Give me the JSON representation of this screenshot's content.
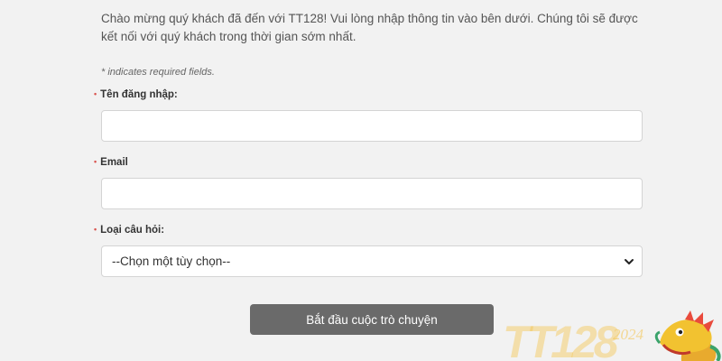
{
  "intro": {
    "text": "Chào mừng quý khách đã đến với TT128! Vui lòng nhập thông tin vào bên dưới. Chúng tôi sẽ được kết nối với quý khách trong thời gian sớm nhất."
  },
  "required_note": "* indicates required fields.",
  "form": {
    "required_mark": "•",
    "username": {
      "label": "Tên đăng nhập:",
      "value": "",
      "placeholder": ""
    },
    "email": {
      "label": "Email",
      "value": "",
      "placeholder": ""
    },
    "question_type": {
      "label": "Loại câu hỏi:",
      "selected": "--Chọn một tùy chọn--"
    },
    "submit_label": "Bắt đầu cuộc trò chuyện"
  },
  "logo": {
    "brand": "TT128",
    "year": "2024"
  },
  "colors": {
    "background": "#f2f2f2",
    "button": "#6a6a6a",
    "required_star": "#d9534f",
    "logo_gold": "#f3c552"
  },
  "icons": {
    "select_arrow": "chevron-down-icon",
    "mascot": "dragon-icon"
  }
}
